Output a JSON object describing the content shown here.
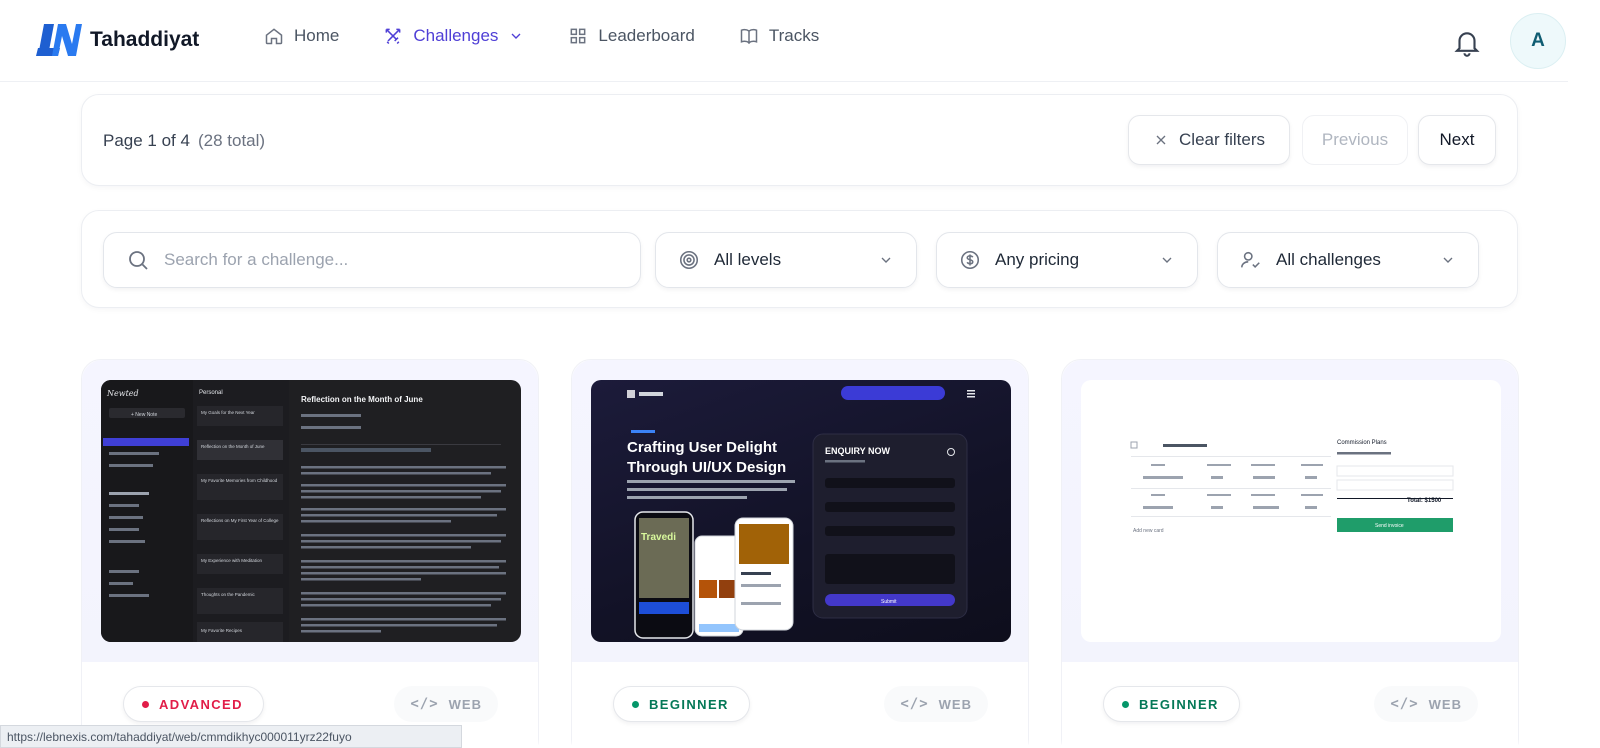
{
  "brand": {
    "name": "Tahaddiyat",
    "accent": "#4f3fd6"
  },
  "nav": [
    {
      "label": "Home",
      "icon": "home-icon",
      "active": false
    },
    {
      "label": "Challenges",
      "icon": "swords-icon",
      "active": true
    },
    {
      "label": "Leaderboard",
      "icon": "grid-icon",
      "active": false
    },
    {
      "label": "Tracks",
      "icon": "book-icon",
      "active": false
    }
  ],
  "user": {
    "avatar_initial": "A"
  },
  "pager": {
    "page_text": "Page 1 of 4",
    "total_text": "(28 total)",
    "clear_label": "Clear filters",
    "prev_label": "Previous",
    "next_label": "Next"
  },
  "filters": {
    "search_placeholder": "Search for a challenge...",
    "level": "All levels",
    "pricing": "Any pricing",
    "type": "All challenges"
  },
  "cards": [
    {
      "level": "ADVANCED",
      "level_color": "#e11d48",
      "tech": "WEB",
      "thumb": {
        "app": "Newted",
        "section": "Personal",
        "doc_title": "Reflection on the Month of June",
        "new_note": "+ New Note",
        "notes": [
          "My Goals for the Next Year",
          "Reflection on the Month of June",
          "My Favorite Memories from Childhood",
          "Reflections on My First Year of College",
          "My Experience with Meditation",
          "Thoughts on the Pandemic",
          "My Favorite Recipes"
        ]
      }
    },
    {
      "level": "BEGINNER",
      "level_color": "#059669",
      "tech": "WEB",
      "thumb": {
        "headline_1": "Crafting User Delight",
        "headline_2": "Through UI/UX Design",
        "form_title": "ENQUIRY NOW",
        "submit": "Submit",
        "phone_label": "Travedi"
      }
    },
    {
      "level": "BEGINNER",
      "level_color": "#059669",
      "tech": "WEB",
      "thumb": {
        "side_title": "Commission Plans",
        "total": "Total: $1500",
        "send": "Send invoice",
        "add_row": "Add new card"
      }
    }
  ],
  "status_url": "https://lebnexis.com/tahaddiyat/web/cmmdikhyc000011yrz22fuyo"
}
